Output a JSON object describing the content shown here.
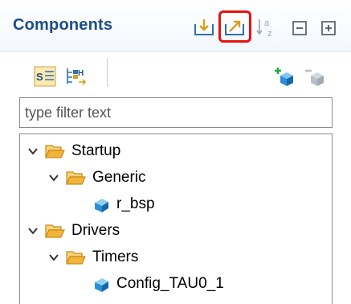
{
  "header": {
    "title": "Components"
  },
  "filter": {
    "placeholder": "type filter text"
  },
  "tree": {
    "nodes": [
      {
        "label": "Startup"
      },
      {
        "label": "Generic"
      },
      {
        "label": "r_bsp"
      },
      {
        "label": "Drivers"
      },
      {
        "label": "Timers"
      },
      {
        "label": "Config_TAU0_1"
      }
    ]
  },
  "colors": {
    "title": "#1c4e86",
    "highlight": "#e81010",
    "folder": "#f2b53b",
    "cube": "#2a8fd8"
  }
}
